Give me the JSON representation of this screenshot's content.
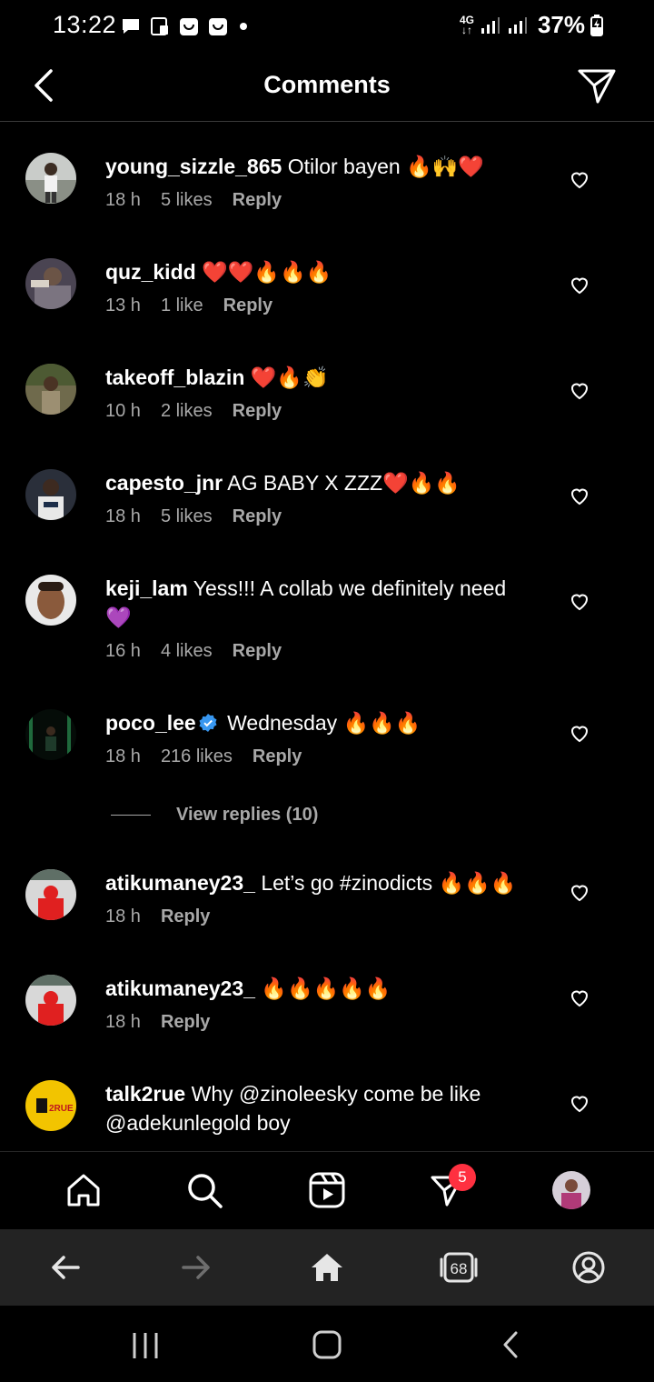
{
  "status_bar": {
    "time": "13:22",
    "network": "4G",
    "battery": "37%"
  },
  "header": {
    "title": "Comments"
  },
  "comments": [
    {
      "username": "young_sizzle_865",
      "text": " Otilor bayen 🔥🙌❤️",
      "time": "18 h",
      "likes": "5 likes",
      "reply": "Reply",
      "verified": false
    },
    {
      "username": "quz_kidd",
      "text": " ❤️❤️🔥🔥🔥",
      "time": "13 h",
      "likes": "1 like",
      "reply": "Reply",
      "verified": false
    },
    {
      "username": "takeoff_blazin",
      "text": " ❤️🔥👏",
      "time": "10 h",
      "likes": "2 likes",
      "reply": "Reply",
      "verified": false
    },
    {
      "username": "capesto_jnr",
      "text": " AG BABY X ZZZ❤️🔥🔥",
      "time": "18 h",
      "likes": "5 likes",
      "reply": "Reply",
      "verified": false
    },
    {
      "username": "keji_lam",
      "text": " Yess!!! A collab we definitely need 💜",
      "time": "16 h",
      "likes": "4 likes",
      "reply": "Reply",
      "verified": false
    },
    {
      "username": "poco_lee",
      "text": " Wednesday 🔥🔥🔥",
      "time": "18 h",
      "likes": "216 likes",
      "reply": "Reply",
      "verified": true
    },
    {
      "username": "atikumaney23_",
      "text": " Let’s go #zinodicts 🔥🔥🔥",
      "time": "18 h",
      "likes": "",
      "reply": "Reply",
      "verified": false
    },
    {
      "username": "atikumaney23_",
      "text": " 🔥🔥🔥🔥🔥",
      "time": "18 h",
      "likes": "",
      "reply": "Reply",
      "verified": false
    },
    {
      "username": "talk2rue",
      "text": " Why @zinoleesky come be like @adekunlegold boy",
      "time": "",
      "likes": "",
      "reply": "",
      "verified": false
    }
  ],
  "view_replies": "View replies (10)",
  "bottom_nav": {
    "badge_count": "5"
  },
  "browser_bar": {
    "tab_count": "68"
  },
  "avatar_logo_text": "2RUE",
  "colors": {
    "background": "#000000",
    "meta": "#a8a8a8",
    "badge": "#ff3040",
    "verified": "#3897f0"
  }
}
